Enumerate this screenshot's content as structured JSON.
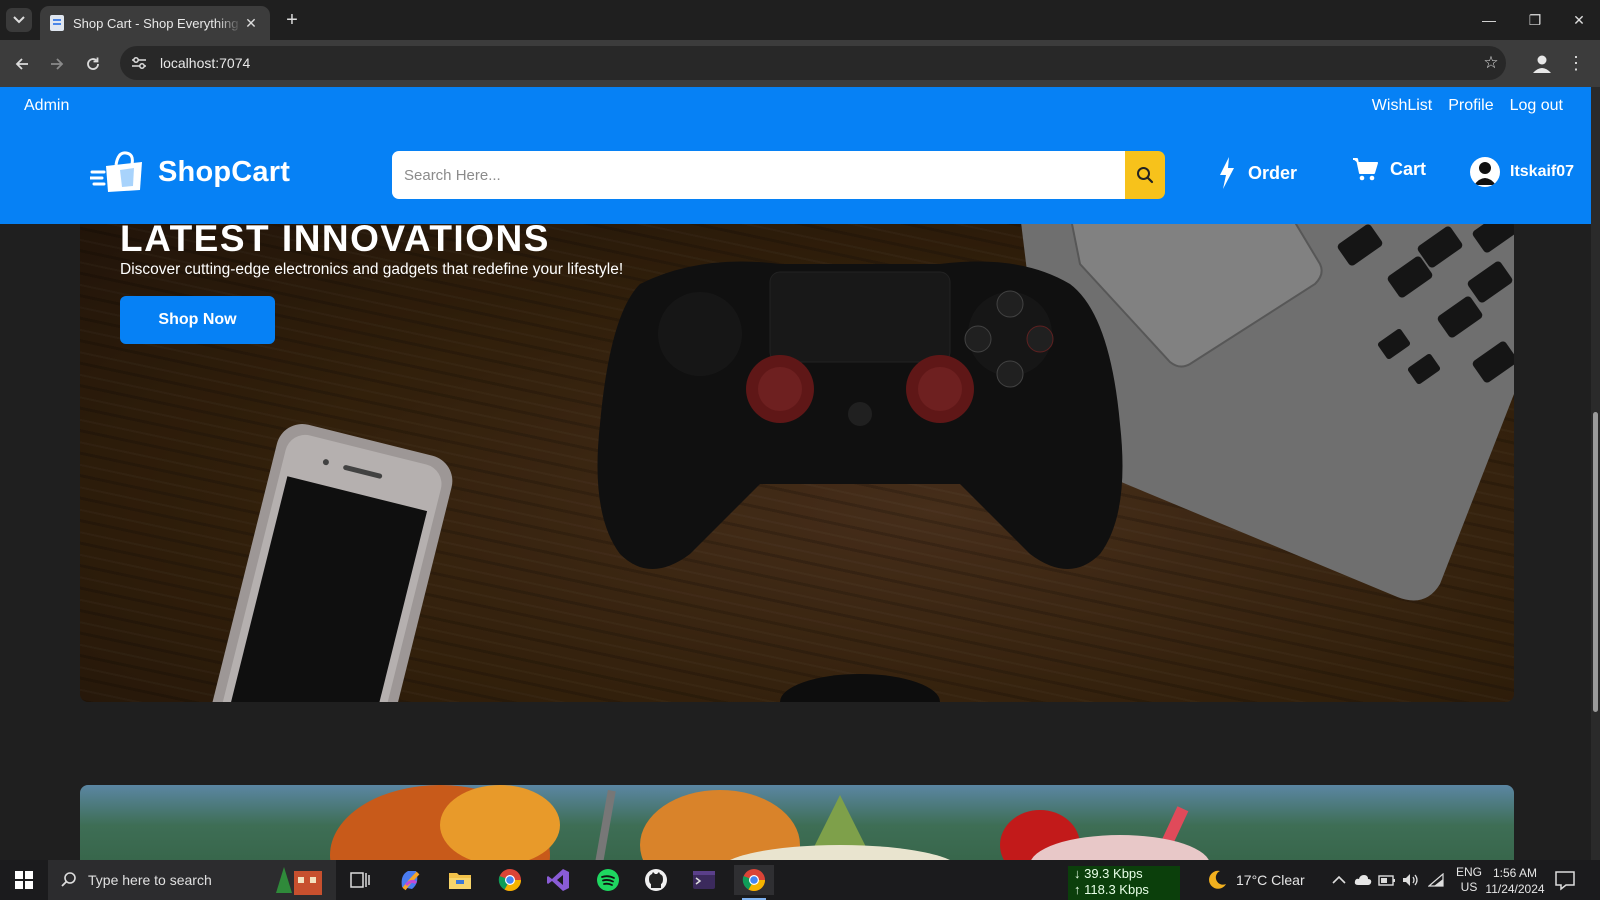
{
  "browser": {
    "tab_title": "Shop Cart - Shop Everything - E",
    "url": "localhost:7074",
    "controls": {
      "minimize": "—",
      "restore": "❐",
      "close": "✕",
      "new_tab": "+"
    }
  },
  "site": {
    "topbar": {
      "admin": "Admin",
      "wishlist": "WishList",
      "profile": "Profile",
      "logout": "Log out"
    },
    "logo_text": "ShopCart",
    "search": {
      "placeholder": "Search Here..."
    },
    "nav": {
      "order": "Order",
      "cart": "Cart",
      "user": "Itskaif07"
    },
    "hero": {
      "title": "LATEST INNOVATIONS",
      "subtitle": "Discover cutting-edge electronics and gadgets that redefine your lifestyle!",
      "button": "Shop Now"
    }
  },
  "taskbar": {
    "search_placeholder": "Type here to search",
    "network": {
      "down": "↓ 39.3 Kbps",
      "up": "↑ 118.3 Kbps"
    },
    "weather": "17°C  Clear",
    "lang_top": "ENG",
    "lang_bottom": "US",
    "time": "1:56 AM",
    "date": "11/24/2024"
  },
  "colors": {
    "brand_blue": "#0681f5",
    "search_button": "#f7c21b",
    "page_background": "#1f1f1f"
  }
}
